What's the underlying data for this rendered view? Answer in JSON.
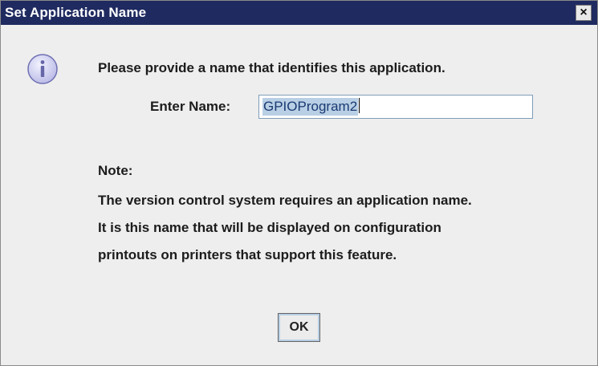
{
  "dialog": {
    "title": "Set Application Name",
    "close_glyph": "✕",
    "icon": "info-icon",
    "prompt": "Please provide a name that identifies this application.",
    "name_label": "Enter Name:",
    "name_value": "GPIOProgram2",
    "note_heading": "Note:",
    "note_lines": [
      "The version control system requires an application name.",
      "It is this name that will be displayed on configuration",
      "printouts on printers that support this feature."
    ],
    "ok_label": "OK"
  },
  "colors": {
    "titlebar": "#1f2a60",
    "background": "#eeeeee",
    "selection": "#b8cfe5"
  }
}
